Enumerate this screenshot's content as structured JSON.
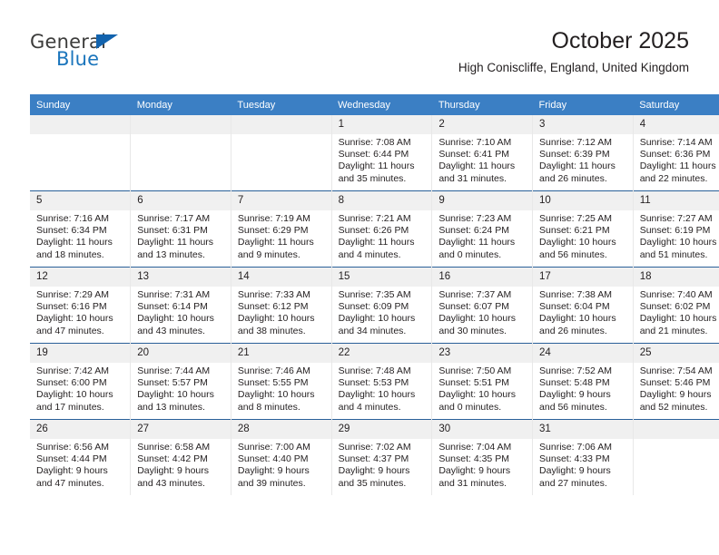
{
  "logo": {
    "word1": "General",
    "word2": "Blue",
    "triangle_color": "#1263ae",
    "blue_color": "#1b75bc"
  },
  "header": {
    "title": "October 2025",
    "subtitle": "High Coniscliffe, England, United Kingdom"
  },
  "theme": {
    "header_bg": "#3b7fc4",
    "row_divider": "#2a6099",
    "daynum_bg": "#f0f0f0",
    "cell_border": "#e8e8e8",
    "text": "#231f20"
  },
  "weekday_headers": [
    "Sunday",
    "Monday",
    "Tuesday",
    "Wednesday",
    "Thursday",
    "Friday",
    "Saturday"
  ],
  "labels": {
    "sunrise": "Sunrise:",
    "sunset": "Sunset:",
    "daylight": "Daylight:"
  },
  "weeks": [
    [
      {
        "day": "",
        "empty": true
      },
      {
        "day": "",
        "empty": true
      },
      {
        "day": "",
        "empty": true
      },
      {
        "day": "1",
        "sunrise": "Sunrise: 7:08 AM",
        "sunset": "Sunset: 6:44 PM",
        "daylight": "Daylight: 11 hours and 35 minutes."
      },
      {
        "day": "2",
        "sunrise": "Sunrise: 7:10 AM",
        "sunset": "Sunset: 6:41 PM",
        "daylight": "Daylight: 11 hours and 31 minutes."
      },
      {
        "day": "3",
        "sunrise": "Sunrise: 7:12 AM",
        "sunset": "Sunset: 6:39 PM",
        "daylight": "Daylight: 11 hours and 26 minutes."
      },
      {
        "day": "4",
        "sunrise": "Sunrise: 7:14 AM",
        "sunset": "Sunset: 6:36 PM",
        "daylight": "Daylight: 11 hours and 22 minutes."
      }
    ],
    [
      {
        "day": "5",
        "sunrise": "Sunrise: 7:16 AM",
        "sunset": "Sunset: 6:34 PM",
        "daylight": "Daylight: 11 hours and 18 minutes."
      },
      {
        "day": "6",
        "sunrise": "Sunrise: 7:17 AM",
        "sunset": "Sunset: 6:31 PM",
        "daylight": "Daylight: 11 hours and 13 minutes."
      },
      {
        "day": "7",
        "sunrise": "Sunrise: 7:19 AM",
        "sunset": "Sunset: 6:29 PM",
        "daylight": "Daylight: 11 hours and 9 minutes."
      },
      {
        "day": "8",
        "sunrise": "Sunrise: 7:21 AM",
        "sunset": "Sunset: 6:26 PM",
        "daylight": "Daylight: 11 hours and 4 minutes."
      },
      {
        "day": "9",
        "sunrise": "Sunrise: 7:23 AM",
        "sunset": "Sunset: 6:24 PM",
        "daylight": "Daylight: 11 hours and 0 minutes."
      },
      {
        "day": "10",
        "sunrise": "Sunrise: 7:25 AM",
        "sunset": "Sunset: 6:21 PM",
        "daylight": "Daylight: 10 hours and 56 minutes."
      },
      {
        "day": "11",
        "sunrise": "Sunrise: 7:27 AM",
        "sunset": "Sunset: 6:19 PM",
        "daylight": "Daylight: 10 hours and 51 minutes."
      }
    ],
    [
      {
        "day": "12",
        "sunrise": "Sunrise: 7:29 AM",
        "sunset": "Sunset: 6:16 PM",
        "daylight": "Daylight: 10 hours and 47 minutes."
      },
      {
        "day": "13",
        "sunrise": "Sunrise: 7:31 AM",
        "sunset": "Sunset: 6:14 PM",
        "daylight": "Daylight: 10 hours and 43 minutes."
      },
      {
        "day": "14",
        "sunrise": "Sunrise: 7:33 AM",
        "sunset": "Sunset: 6:12 PM",
        "daylight": "Daylight: 10 hours and 38 minutes."
      },
      {
        "day": "15",
        "sunrise": "Sunrise: 7:35 AM",
        "sunset": "Sunset: 6:09 PM",
        "daylight": "Daylight: 10 hours and 34 minutes."
      },
      {
        "day": "16",
        "sunrise": "Sunrise: 7:37 AM",
        "sunset": "Sunset: 6:07 PM",
        "daylight": "Daylight: 10 hours and 30 minutes."
      },
      {
        "day": "17",
        "sunrise": "Sunrise: 7:38 AM",
        "sunset": "Sunset: 6:04 PM",
        "daylight": "Daylight: 10 hours and 26 minutes."
      },
      {
        "day": "18",
        "sunrise": "Sunrise: 7:40 AM",
        "sunset": "Sunset: 6:02 PM",
        "daylight": "Daylight: 10 hours and 21 minutes."
      }
    ],
    [
      {
        "day": "19",
        "sunrise": "Sunrise: 7:42 AM",
        "sunset": "Sunset: 6:00 PM",
        "daylight": "Daylight: 10 hours and 17 minutes."
      },
      {
        "day": "20",
        "sunrise": "Sunrise: 7:44 AM",
        "sunset": "Sunset: 5:57 PM",
        "daylight": "Daylight: 10 hours and 13 minutes."
      },
      {
        "day": "21",
        "sunrise": "Sunrise: 7:46 AM",
        "sunset": "Sunset: 5:55 PM",
        "daylight": "Daylight: 10 hours and 8 minutes."
      },
      {
        "day": "22",
        "sunrise": "Sunrise: 7:48 AM",
        "sunset": "Sunset: 5:53 PM",
        "daylight": "Daylight: 10 hours and 4 minutes."
      },
      {
        "day": "23",
        "sunrise": "Sunrise: 7:50 AM",
        "sunset": "Sunset: 5:51 PM",
        "daylight": "Daylight: 10 hours and 0 minutes."
      },
      {
        "day": "24",
        "sunrise": "Sunrise: 7:52 AM",
        "sunset": "Sunset: 5:48 PM",
        "daylight": "Daylight: 9 hours and 56 minutes."
      },
      {
        "day": "25",
        "sunrise": "Sunrise: 7:54 AM",
        "sunset": "Sunset: 5:46 PM",
        "daylight": "Daylight: 9 hours and 52 minutes."
      }
    ],
    [
      {
        "day": "26",
        "sunrise": "Sunrise: 6:56 AM",
        "sunset": "Sunset: 4:44 PM",
        "daylight": "Daylight: 9 hours and 47 minutes."
      },
      {
        "day": "27",
        "sunrise": "Sunrise: 6:58 AM",
        "sunset": "Sunset: 4:42 PM",
        "daylight": "Daylight: 9 hours and 43 minutes."
      },
      {
        "day": "28",
        "sunrise": "Sunrise: 7:00 AM",
        "sunset": "Sunset: 4:40 PM",
        "daylight": "Daylight: 9 hours and 39 minutes."
      },
      {
        "day": "29",
        "sunrise": "Sunrise: 7:02 AM",
        "sunset": "Sunset: 4:37 PM",
        "daylight": "Daylight: 9 hours and 35 minutes."
      },
      {
        "day": "30",
        "sunrise": "Sunrise: 7:04 AM",
        "sunset": "Sunset: 4:35 PM",
        "daylight": "Daylight: 9 hours and 31 minutes."
      },
      {
        "day": "31",
        "sunrise": "Sunrise: 7:06 AM",
        "sunset": "Sunset: 4:33 PM",
        "daylight": "Daylight: 9 hours and 27 minutes."
      },
      {
        "day": "",
        "empty": true
      }
    ]
  ]
}
